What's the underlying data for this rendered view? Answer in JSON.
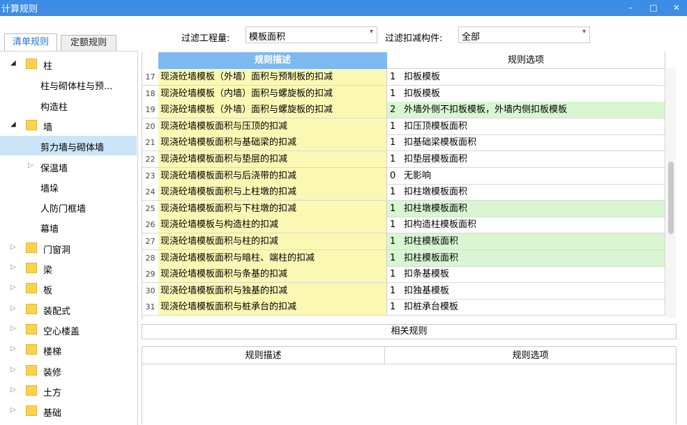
{
  "window": {
    "title": "计算规则",
    "minimize": "–",
    "maximize": "□",
    "close": "✕"
  },
  "tabs": [
    {
      "label": "清单规则",
      "active": true
    },
    {
      "label": "定额规则",
      "active": false
    }
  ],
  "filters": {
    "project_label": "过滤工程量:",
    "project_value": "模板面积",
    "component_label": "过滤扣减构件:",
    "component_value": "全部"
  },
  "tree": [
    {
      "label": "柱",
      "toggle": "expanded",
      "folder": true
    },
    {
      "label": "柱与砌体柱与预...",
      "toggle": "none",
      "folder": false
    },
    {
      "label": "构造柱",
      "toggle": "none",
      "folder": false
    },
    {
      "label": "墙",
      "toggle": "expanded",
      "folder": true
    },
    {
      "label": "剪力墙与砌体墙",
      "toggle": "none",
      "folder": false,
      "selected": true
    },
    {
      "label": "保温墙",
      "toggle": "collapsed",
      "folder": false
    },
    {
      "label": "墙垛",
      "toggle": "none",
      "folder": false
    },
    {
      "label": "人防门框墙",
      "toggle": "none",
      "folder": false
    },
    {
      "label": "幕墙",
      "toggle": "none",
      "folder": false
    },
    {
      "label": "门窗洞",
      "toggle": "collapsed",
      "folder": true
    },
    {
      "label": "梁",
      "toggle": "collapsed",
      "folder": true
    },
    {
      "label": "板",
      "toggle": "collapsed",
      "folder": true
    },
    {
      "label": "装配式",
      "toggle": "collapsed",
      "folder": true
    },
    {
      "label": "空心楼盖",
      "toggle": "collapsed",
      "folder": true
    },
    {
      "label": "楼梯",
      "toggle": "collapsed",
      "folder": true
    },
    {
      "label": "装修",
      "toggle": "collapsed",
      "folder": true
    },
    {
      "label": "土方",
      "toggle": "collapsed",
      "folder": true
    },
    {
      "label": "基础",
      "toggle": "collapsed",
      "folder": true
    }
  ],
  "grid": {
    "col_desc": "规则描述",
    "col_option": "规则选项",
    "rows": [
      {
        "num": "17",
        "desc": "现浇砼墙模板（外墙）面积与预制板的扣减",
        "opt_num": "1",
        "opt_text": "扣板模板",
        "hl": false
      },
      {
        "num": "18",
        "desc": "现浇砼墙模板（内墙）面积与螺旋板的扣减",
        "opt_num": "1",
        "opt_text": "扣板模板",
        "hl": false
      },
      {
        "num": "19",
        "desc": "现浇砼墙模板（外墙）面积与螺旋板的扣减",
        "opt_num": "2",
        "opt_text": "外墙外侧不扣板模板，外墙内侧扣板模板",
        "hl": true
      },
      {
        "num": "20",
        "desc": "现浇砼墙模板面积与压顶的扣减",
        "opt_num": "1",
        "opt_text": "扣压顶模板面积",
        "hl": false
      },
      {
        "num": "21",
        "desc": "现浇砼墙模板面积与基础梁的扣减",
        "opt_num": "1",
        "opt_text": "扣基础梁模板面积",
        "hl": false
      },
      {
        "num": "22",
        "desc": "现浇砼墙模板面积与垫层的扣减",
        "opt_num": "1",
        "opt_text": "扣垫层模板面积",
        "hl": false
      },
      {
        "num": "23",
        "desc": "现浇砼墙模板面积与后浇带的扣减",
        "opt_num": "0",
        "opt_text": "无影响",
        "hl": false
      },
      {
        "num": "24",
        "desc": "现浇砼墙模板面积与上柱墩的扣减",
        "opt_num": "1",
        "opt_text": "扣柱墩模板面积",
        "hl": false
      },
      {
        "num": "25",
        "desc": "现浇砼墙模板面积与下柱墩的扣减",
        "opt_num": "1",
        "opt_text": "扣柱墩模板面积",
        "hl": true
      },
      {
        "num": "26",
        "desc": "现浇砼墙模板与构造柱的扣减",
        "opt_num": "1",
        "opt_text": "扣构造柱模板面积",
        "hl": false
      },
      {
        "num": "27",
        "desc": "现浇砼墙模板面积与柱的扣减",
        "opt_num": "1",
        "opt_text": "扣柱模板面积",
        "hl": true
      },
      {
        "num": "28",
        "desc": "现浇砼墙模板面积与暗柱、端柱的扣减",
        "opt_num": "1",
        "opt_text": "扣柱模板面积",
        "hl": true
      },
      {
        "num": "29",
        "desc": "现浇砼墙模板面积与条基的扣减",
        "opt_num": "1",
        "opt_text": "扣条基模板",
        "hl": false
      },
      {
        "num": "30",
        "desc": "现浇砼墙模板面积与独基的扣减",
        "opt_num": "1",
        "opt_text": "扣独基模板",
        "hl": false
      },
      {
        "num": "31",
        "desc": "现浇砼墙模板面积与桩承台的扣减",
        "opt_num": "1",
        "opt_text": "扣桩承台模板",
        "hl": false
      }
    ]
  },
  "related": {
    "title": "相关规则",
    "col_desc": "规则描述",
    "col_option": "规则选项"
  },
  "colors": {
    "titlebar": "#3d8ce5",
    "header_blue": "#7db9f0",
    "desc_yellow": "#fbf8b4",
    "option_green": "#d8f6d2",
    "selected": "#cce4f7",
    "folder": "#fbd24e"
  }
}
